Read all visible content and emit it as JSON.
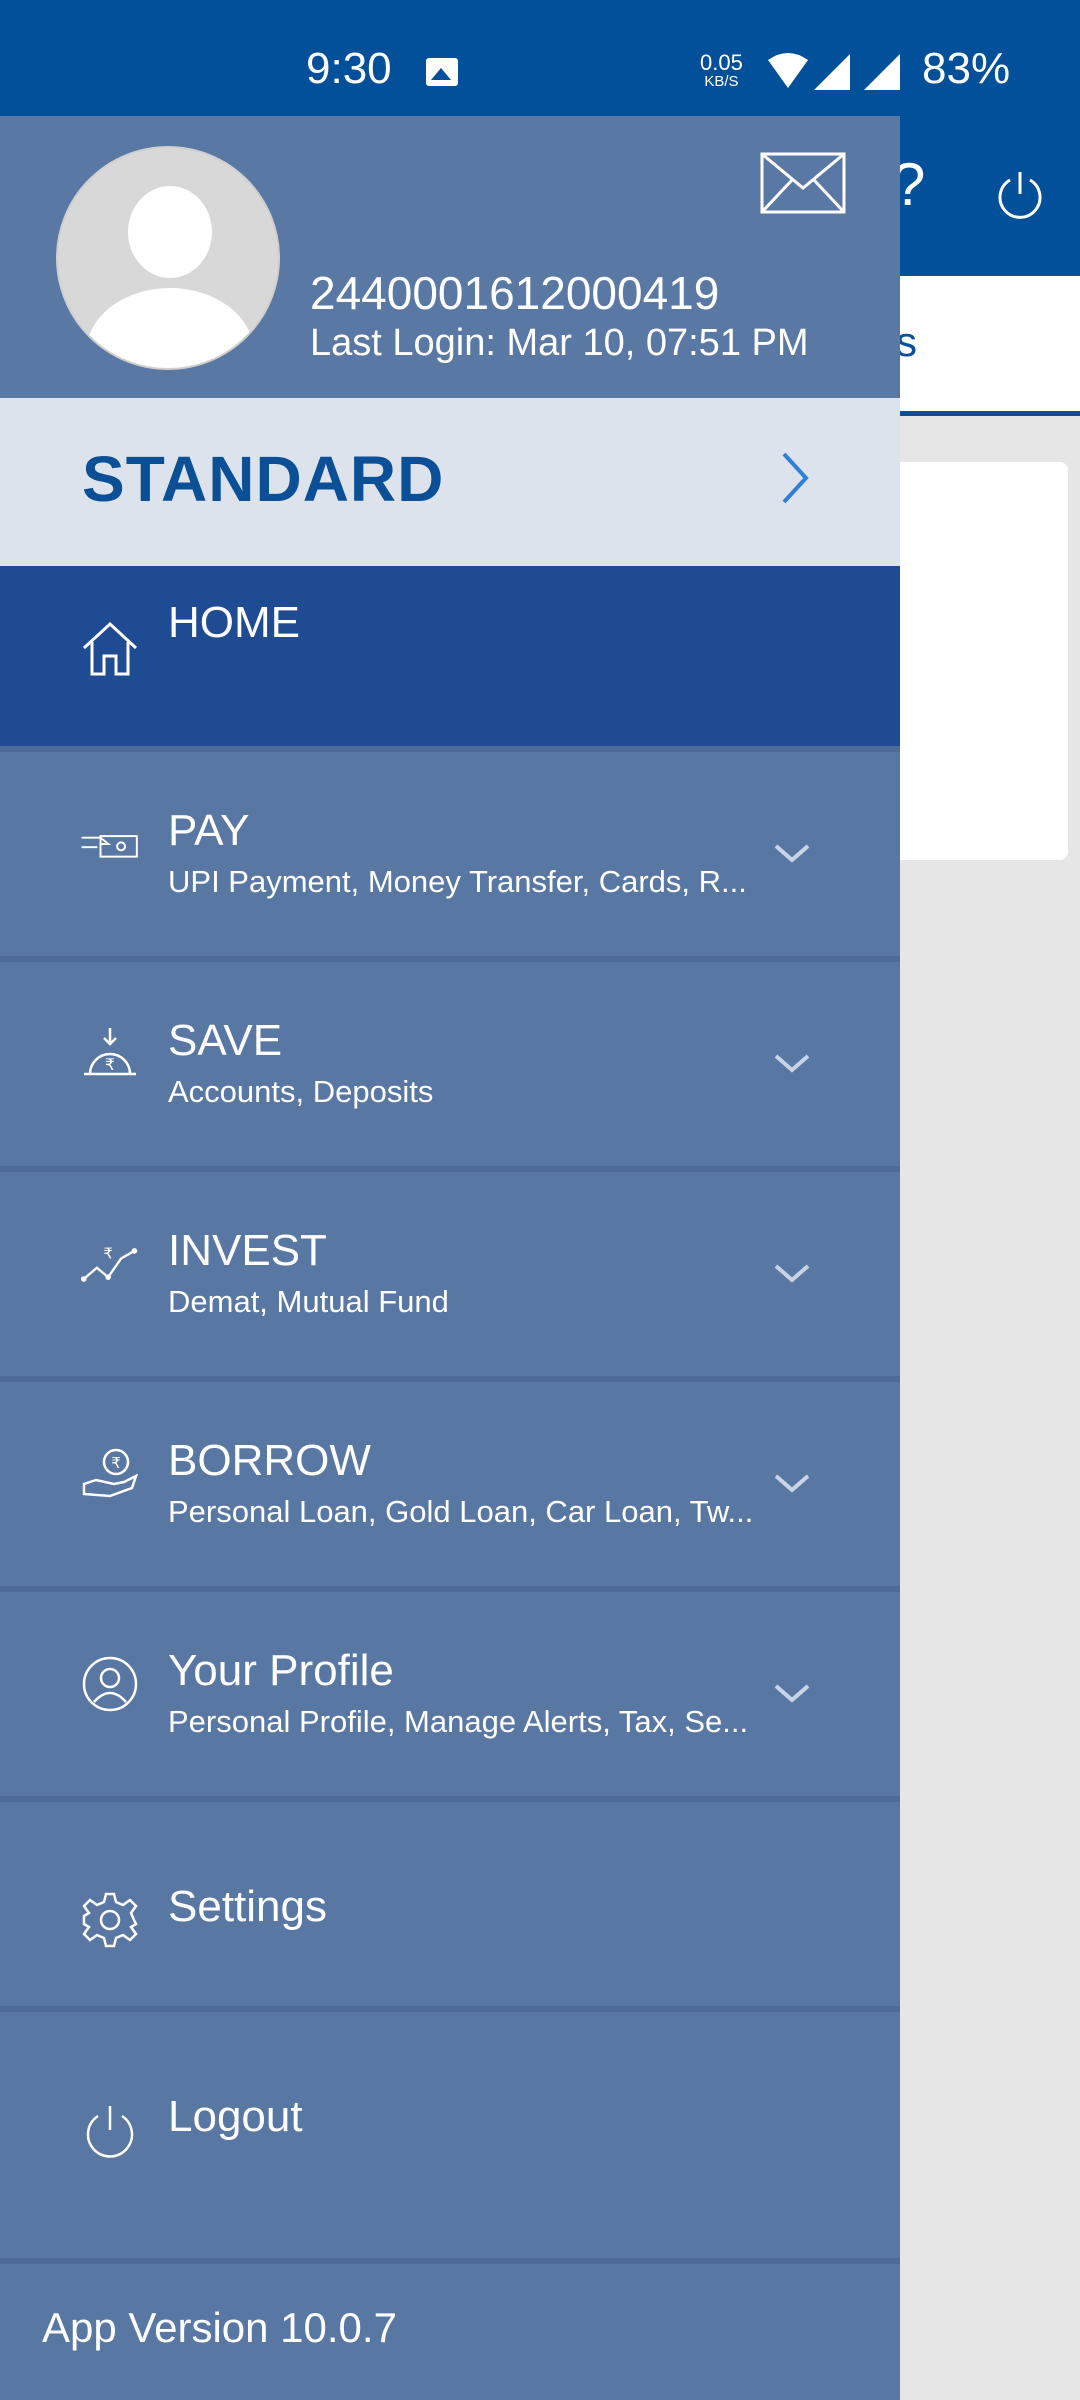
{
  "status_bar": {
    "time": "9:30",
    "net_speed_value": "0.05",
    "net_speed_unit": "KB/S",
    "battery": "83%",
    "icons": [
      "image-icon",
      "wifi-icon",
      "signal-icon",
      "signal-icon"
    ]
  },
  "background": {
    "tab_fragment": "s",
    "header_icons": [
      "help-icon",
      "power-icon"
    ]
  },
  "drawer": {
    "account_number": "2440001612000419",
    "last_login": "Last Login: Mar 10, 07:51 PM",
    "tier_label": "STANDARD",
    "menu": [
      {
        "title": "HOME",
        "subtitle": "",
        "icon": "home-icon",
        "active": true
      },
      {
        "title": "PAY",
        "subtitle": "UPI Payment, Money Transfer, Cards, R...",
        "icon": "pay-icon"
      },
      {
        "title": "SAVE",
        "subtitle": "Accounts, Deposits",
        "icon": "save-icon"
      },
      {
        "title": "INVEST",
        "subtitle": "Demat, Mutual Fund",
        "icon": "invest-icon"
      },
      {
        "title": "BORROW",
        "subtitle": "Personal Loan, Gold Loan, Car Loan, Tw...",
        "icon": "borrow-icon"
      },
      {
        "title": "Your Profile",
        "subtitle": "Personal Profile, Manage Alerts, Tax, Se...",
        "icon": "profile-icon"
      },
      {
        "title": "Settings",
        "subtitle": "",
        "icon": "gear-icon"
      },
      {
        "title": "Logout",
        "subtitle": "",
        "icon": "power-icon"
      }
    ],
    "app_version": "App Version 10.0.7"
  },
  "colors": {
    "brand_blue": "#03509a",
    "drawer_bg": "#5977a3",
    "active_item": "#1e4b91",
    "tier_bg": "#dce3ec"
  }
}
